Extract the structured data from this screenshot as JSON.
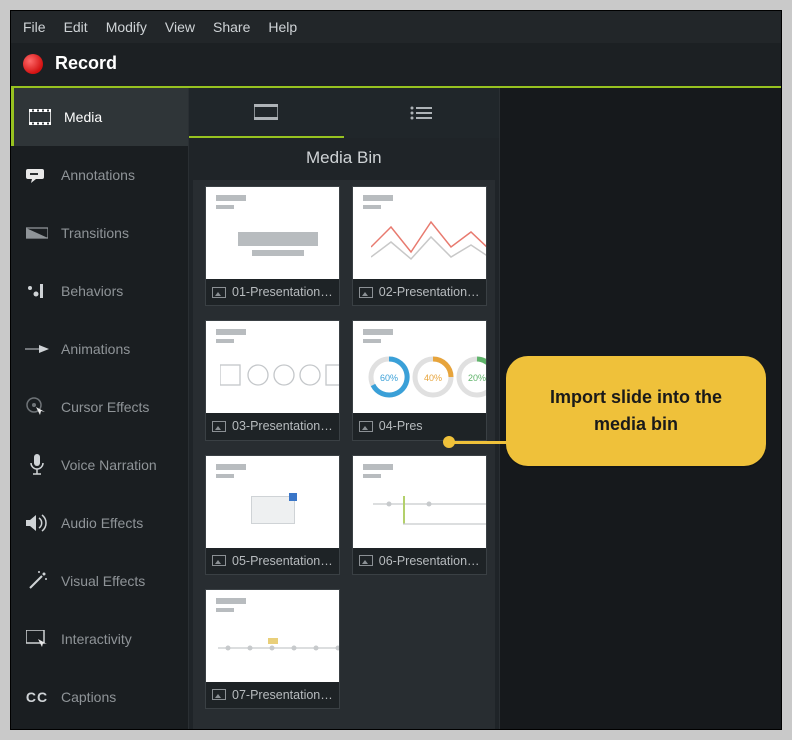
{
  "menu": [
    "File",
    "Edit",
    "Modify",
    "View",
    "Share",
    "Help"
  ],
  "record_label": "Record",
  "sidebar": {
    "items": [
      {
        "label": "Media",
        "icon": "film-icon",
        "active": true
      },
      {
        "label": "Annotations",
        "icon": "annotation-icon"
      },
      {
        "label": "Transitions",
        "icon": "transitions-icon"
      },
      {
        "label": "Behaviors",
        "icon": "behaviors-icon"
      },
      {
        "label": "Animations",
        "icon": "animations-icon"
      },
      {
        "label": "Cursor Effects",
        "icon": "cursor-effects-icon"
      },
      {
        "label": "Voice Narration",
        "icon": "mic-icon"
      },
      {
        "label": "Audio Effects",
        "icon": "speaker-icon"
      },
      {
        "label": "Visual Effects",
        "icon": "wand-icon"
      },
      {
        "label": "Interactivity",
        "icon": "interactivity-icon"
      },
      {
        "label": "Captions",
        "icon": "cc-icon"
      }
    ]
  },
  "media_bin": {
    "title": "Media Bin",
    "items": [
      {
        "label": "01-Presentation…"
      },
      {
        "label": "02-Presentation…"
      },
      {
        "label": "03-Presentation…"
      },
      {
        "label": "04-Pres"
      },
      {
        "label": "05-Presentation…"
      },
      {
        "label": "06-Presentation…"
      },
      {
        "label": "07-Presentation…"
      }
    ]
  },
  "callout_text": "Import slide into the media bin"
}
